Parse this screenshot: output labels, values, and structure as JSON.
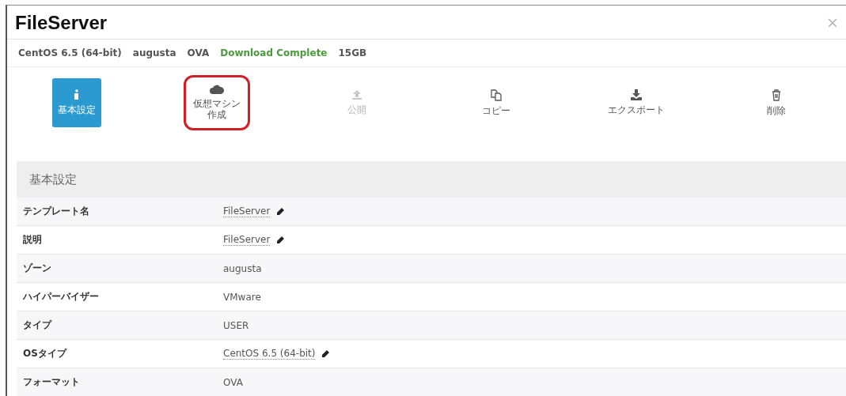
{
  "dialog": {
    "title": "FileServer",
    "close": "×"
  },
  "info": [
    {
      "text": "CentOS 6.5 (64-bit)",
      "kind": "plain"
    },
    {
      "text": "augusta",
      "kind": "plain"
    },
    {
      "text": "OVA",
      "kind": "plain"
    },
    {
      "text": "Download Complete",
      "kind": "status"
    },
    {
      "text": "15GB",
      "kind": "plain"
    }
  ],
  "actions": [
    {
      "label": "基本設定",
      "selected": true,
      "disabled": false,
      "highlighted": false
    },
    {
      "label": "仮想マシン作成",
      "selected": false,
      "disabled": false,
      "highlighted": true
    },
    {
      "label": "公開",
      "selected": false,
      "disabled": true,
      "highlighted": false
    },
    {
      "label": "コピー",
      "selected": false,
      "disabled": false,
      "highlighted": false
    },
    {
      "label": "エクスポート",
      "selected": false,
      "disabled": false,
      "highlighted": false
    },
    {
      "label": "削除",
      "selected": false,
      "disabled": false,
      "highlighted": false
    }
  ],
  "details": {
    "heading": "基本設定",
    "rows": [
      {
        "label": "テンプレート名",
        "value": "FileServer",
        "editable": true
      },
      {
        "label": "説明",
        "value": "FileServer",
        "editable": true
      },
      {
        "label": "ゾーン",
        "value": "augusta",
        "editable": false
      },
      {
        "label": "ハイパーバイザー",
        "value": "VMware",
        "editable": false
      },
      {
        "label": "タイプ",
        "value": "USER",
        "editable": false
      },
      {
        "label": "OSタイプ",
        "value": "CentOS 6.5 (64-bit)",
        "editable": true
      },
      {
        "label": "フォーマット",
        "value": "OVA",
        "editable": false
      }
    ]
  }
}
